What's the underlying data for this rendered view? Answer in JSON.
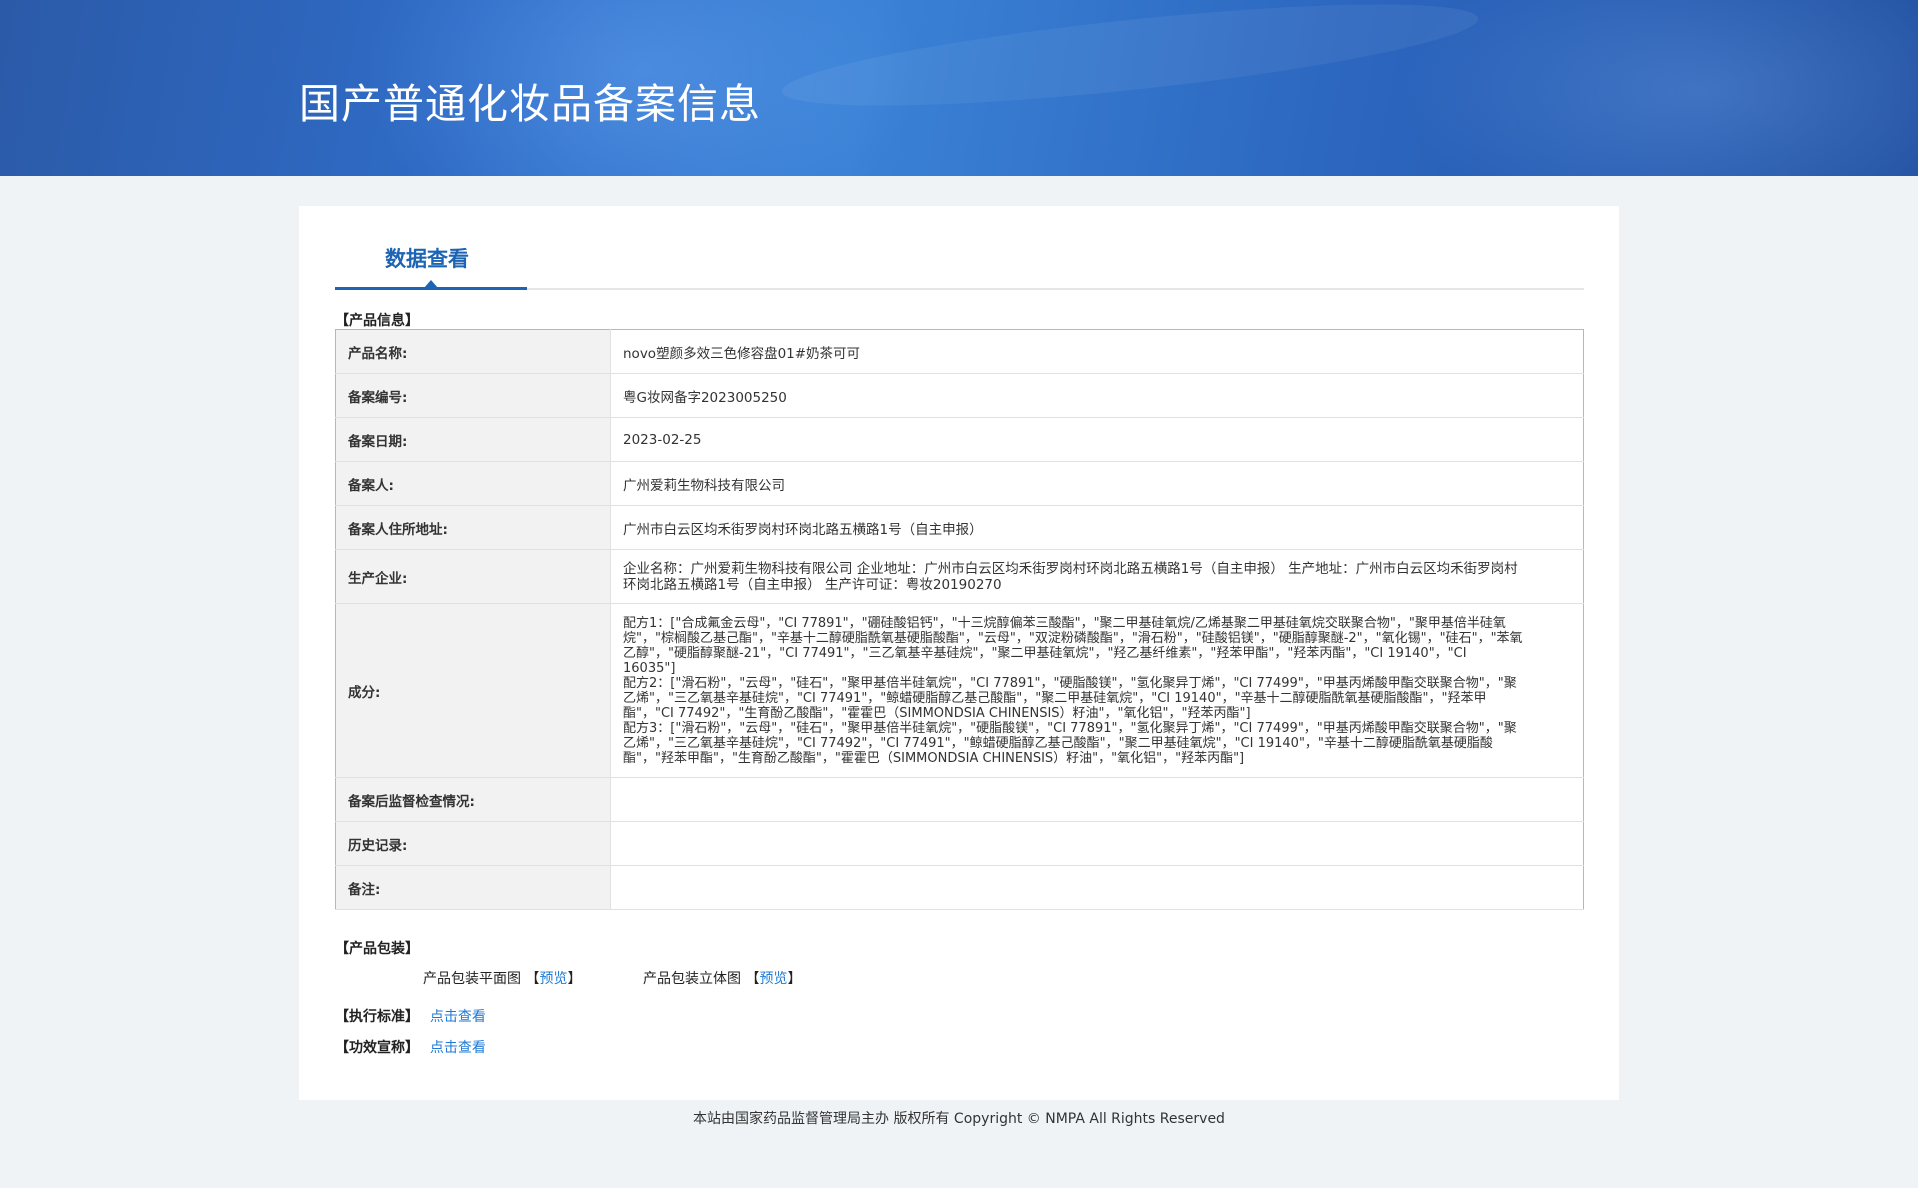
{
  "banner": {
    "title": "国产普通化妆品备案信息"
  },
  "tabs": [
    {
      "label": "数据查看"
    }
  ],
  "sections": {
    "product_info": "【产品信息】",
    "packaging": "【产品包装】",
    "standard": "【执行标准】",
    "efficacy": "【功效宣称】"
  },
  "info_rows": [
    {
      "label": "产品名称:",
      "value": "novo塑颜多效三色修容盘01#奶茶可可"
    },
    {
      "label": "备案编号:",
      "value": "粤G妆网备字2023005250"
    },
    {
      "label": "备案日期:",
      "value": "2023-02-25"
    },
    {
      "label": "备案人:",
      "value": "广州爱莉生物科技有限公司"
    },
    {
      "label": "备案人住所地址:",
      "value": "广州市白云区均禾街罗岗村环岗北路五横路1号（自主申报）"
    },
    {
      "label": "生产企业:",
      "value": "企业名称：广州爱莉生物科技有限公司 企业地址：广州市白云区均禾街罗岗村环岗北路五横路1号（自主申报） 生产地址：广州市白云区均禾街罗岗村环岗北路五横路1号（自主申报） 生产许可证：粤妆20190270"
    },
    {
      "label": "成分:",
      "value": "配方1：[\"合成氟金云母\"，\"CI 77891\"，\"硼硅酸铝钙\"，\"十三烷醇偏苯三酸酯\"，\"聚二甲基硅氧烷/乙烯基聚二甲基硅氧烷交联聚合物\"，\"聚甲基倍半硅氧烷\"，\"棕榈酸乙基己酯\"，\"辛基十二醇硬脂酰氧基硬脂酸酯\"，\"云母\"，\"双淀粉磷酸酯\"，\"滑石粉\"，\"硅酸铝镁\"，\"硬脂醇聚醚-2\"，\"氧化锡\"，\"硅石\"，\"苯氧乙醇\"，\"硬脂醇聚醚-21\"，\"CI 77491\"，\"三乙氧基辛基硅烷\"，\"聚二甲基硅氧烷\"，\"羟乙基纤维素\"，\"羟苯甲酯\"，\"羟苯丙酯\"，\"CI 19140\"，\"CI 16035\"]\n配方2：[\"滑石粉\"，\"云母\"，\"硅石\"，\"聚甲基倍半硅氧烷\"，\"CI 77891\"，\"硬脂酸镁\"，\"氢化聚异丁烯\"，\"CI 77499\"，\"甲基丙烯酸甲酯交联聚合物\"，\"聚乙烯\"，\"三乙氧基辛基硅烷\"，\"CI 77491\"，\"鲸蜡硬脂醇乙基己酸酯\"，\"聚二甲基硅氧烷\"，\"CI 19140\"，\"辛基十二醇硬脂酰氧基硬脂酸酯\"，\"羟苯甲酯\"，\"CI 77492\"，\"生育酚乙酸酯\"，\"霍霍巴（SIMMONDSIA CHINENSIS）籽油\"，\"氧化铝\"，\"羟苯丙酯\"]\n配方3：[\"滑石粉\"，\"云母\"，\"硅石\"，\"聚甲基倍半硅氧烷\"，\"硬脂酸镁\"，\"CI 77891\"，\"氢化聚异丁烯\"，\"CI 77499\"，\"甲基丙烯酸甲酯交联聚合物\"，\"聚乙烯\"，\"三乙氧基辛基硅烷\"，\"CI 77492\"，\"CI 77491\"，\"鲸蜡硬脂醇乙基己酸酯\"，\"聚二甲基硅氧烷\"，\"CI 19140\"，\"辛基十二醇硬脂酰氧基硬脂酸酯\"，\"羟苯甲酯\"，\"生育酚乙酸酯\"，\"霍霍巴（SIMMONDSIA CHINENSIS）籽油\"，\"氧化铝\"，\"羟苯丙酯\"]"
    },
    {
      "label": "备案后监督检查情况:",
      "value": ""
    },
    {
      "label": "历史记录:",
      "value": ""
    },
    {
      "label": "备注:",
      "value": ""
    }
  ],
  "packaging": {
    "flat_label": "产品包装平面图",
    "solid_label": "产品包装立体图",
    "preview_link": "预览",
    "bracket_open": "【",
    "bracket_close": "】"
  },
  "links": {
    "view": "点击查看"
  },
  "footer": {
    "text": "本站由国家药品监督管理局主办 版权所有 Copyright © NMPA All Rights Reserved"
  }
}
